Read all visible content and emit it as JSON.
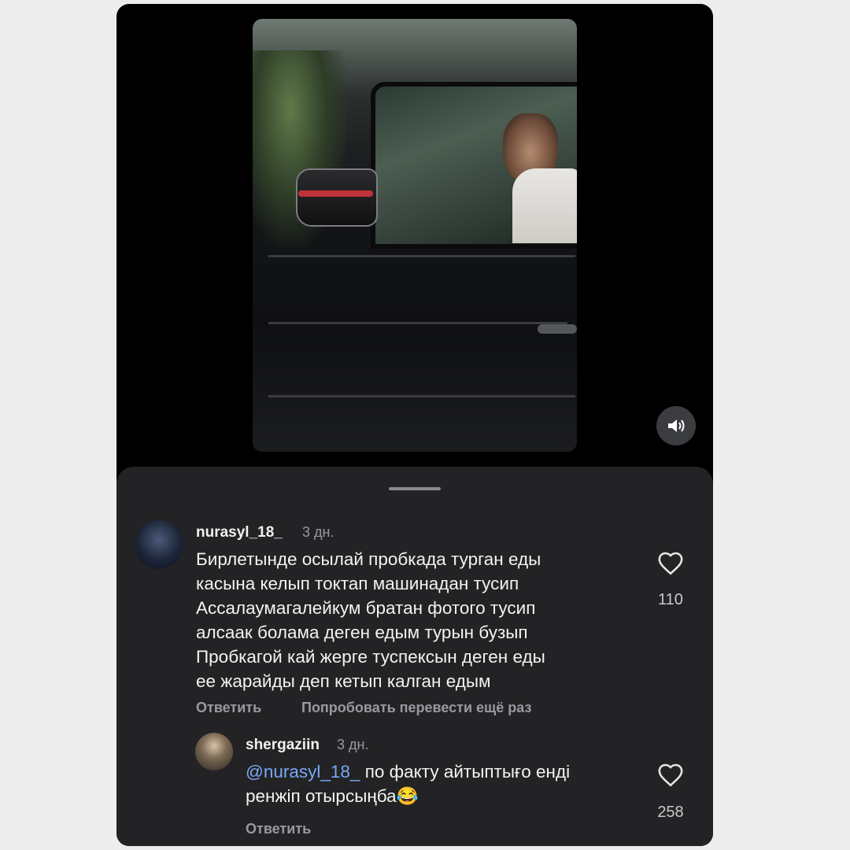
{
  "video": {
    "sound_icon": "volume-icon"
  },
  "comments": [
    {
      "username": "nurasyl_18_",
      "time": "3 дн.",
      "text": "Бирлетынде осылай пробкада турган еды\nкасына келып токтап машинадан тусип\nАссалаумагалейкум братан фотого тусип\nалсаак болама деген едым турын бузып\nПробкагой кай жерге туспексын деген еды\nее жарайды деп кетып калган едым",
      "reply_label": "Ответить",
      "translate_label": "Попробовать перевести ещё раз",
      "likes": "110",
      "icon": "heart-icon"
    },
    {
      "username": "shergaziin",
      "time": "3 дн.",
      "mention": "@nurasyl_18_",
      "text_line1": " по факту айтыптығо енді",
      "text_line2": "ренжіп отырсыңба😂",
      "reply_label": "Ответить",
      "likes": "258",
      "icon": "heart-icon"
    }
  ],
  "colors": {
    "sheet_bg": "#232325",
    "mention": "#7aa7f5",
    "muted_text": "#9a9a9e"
  }
}
